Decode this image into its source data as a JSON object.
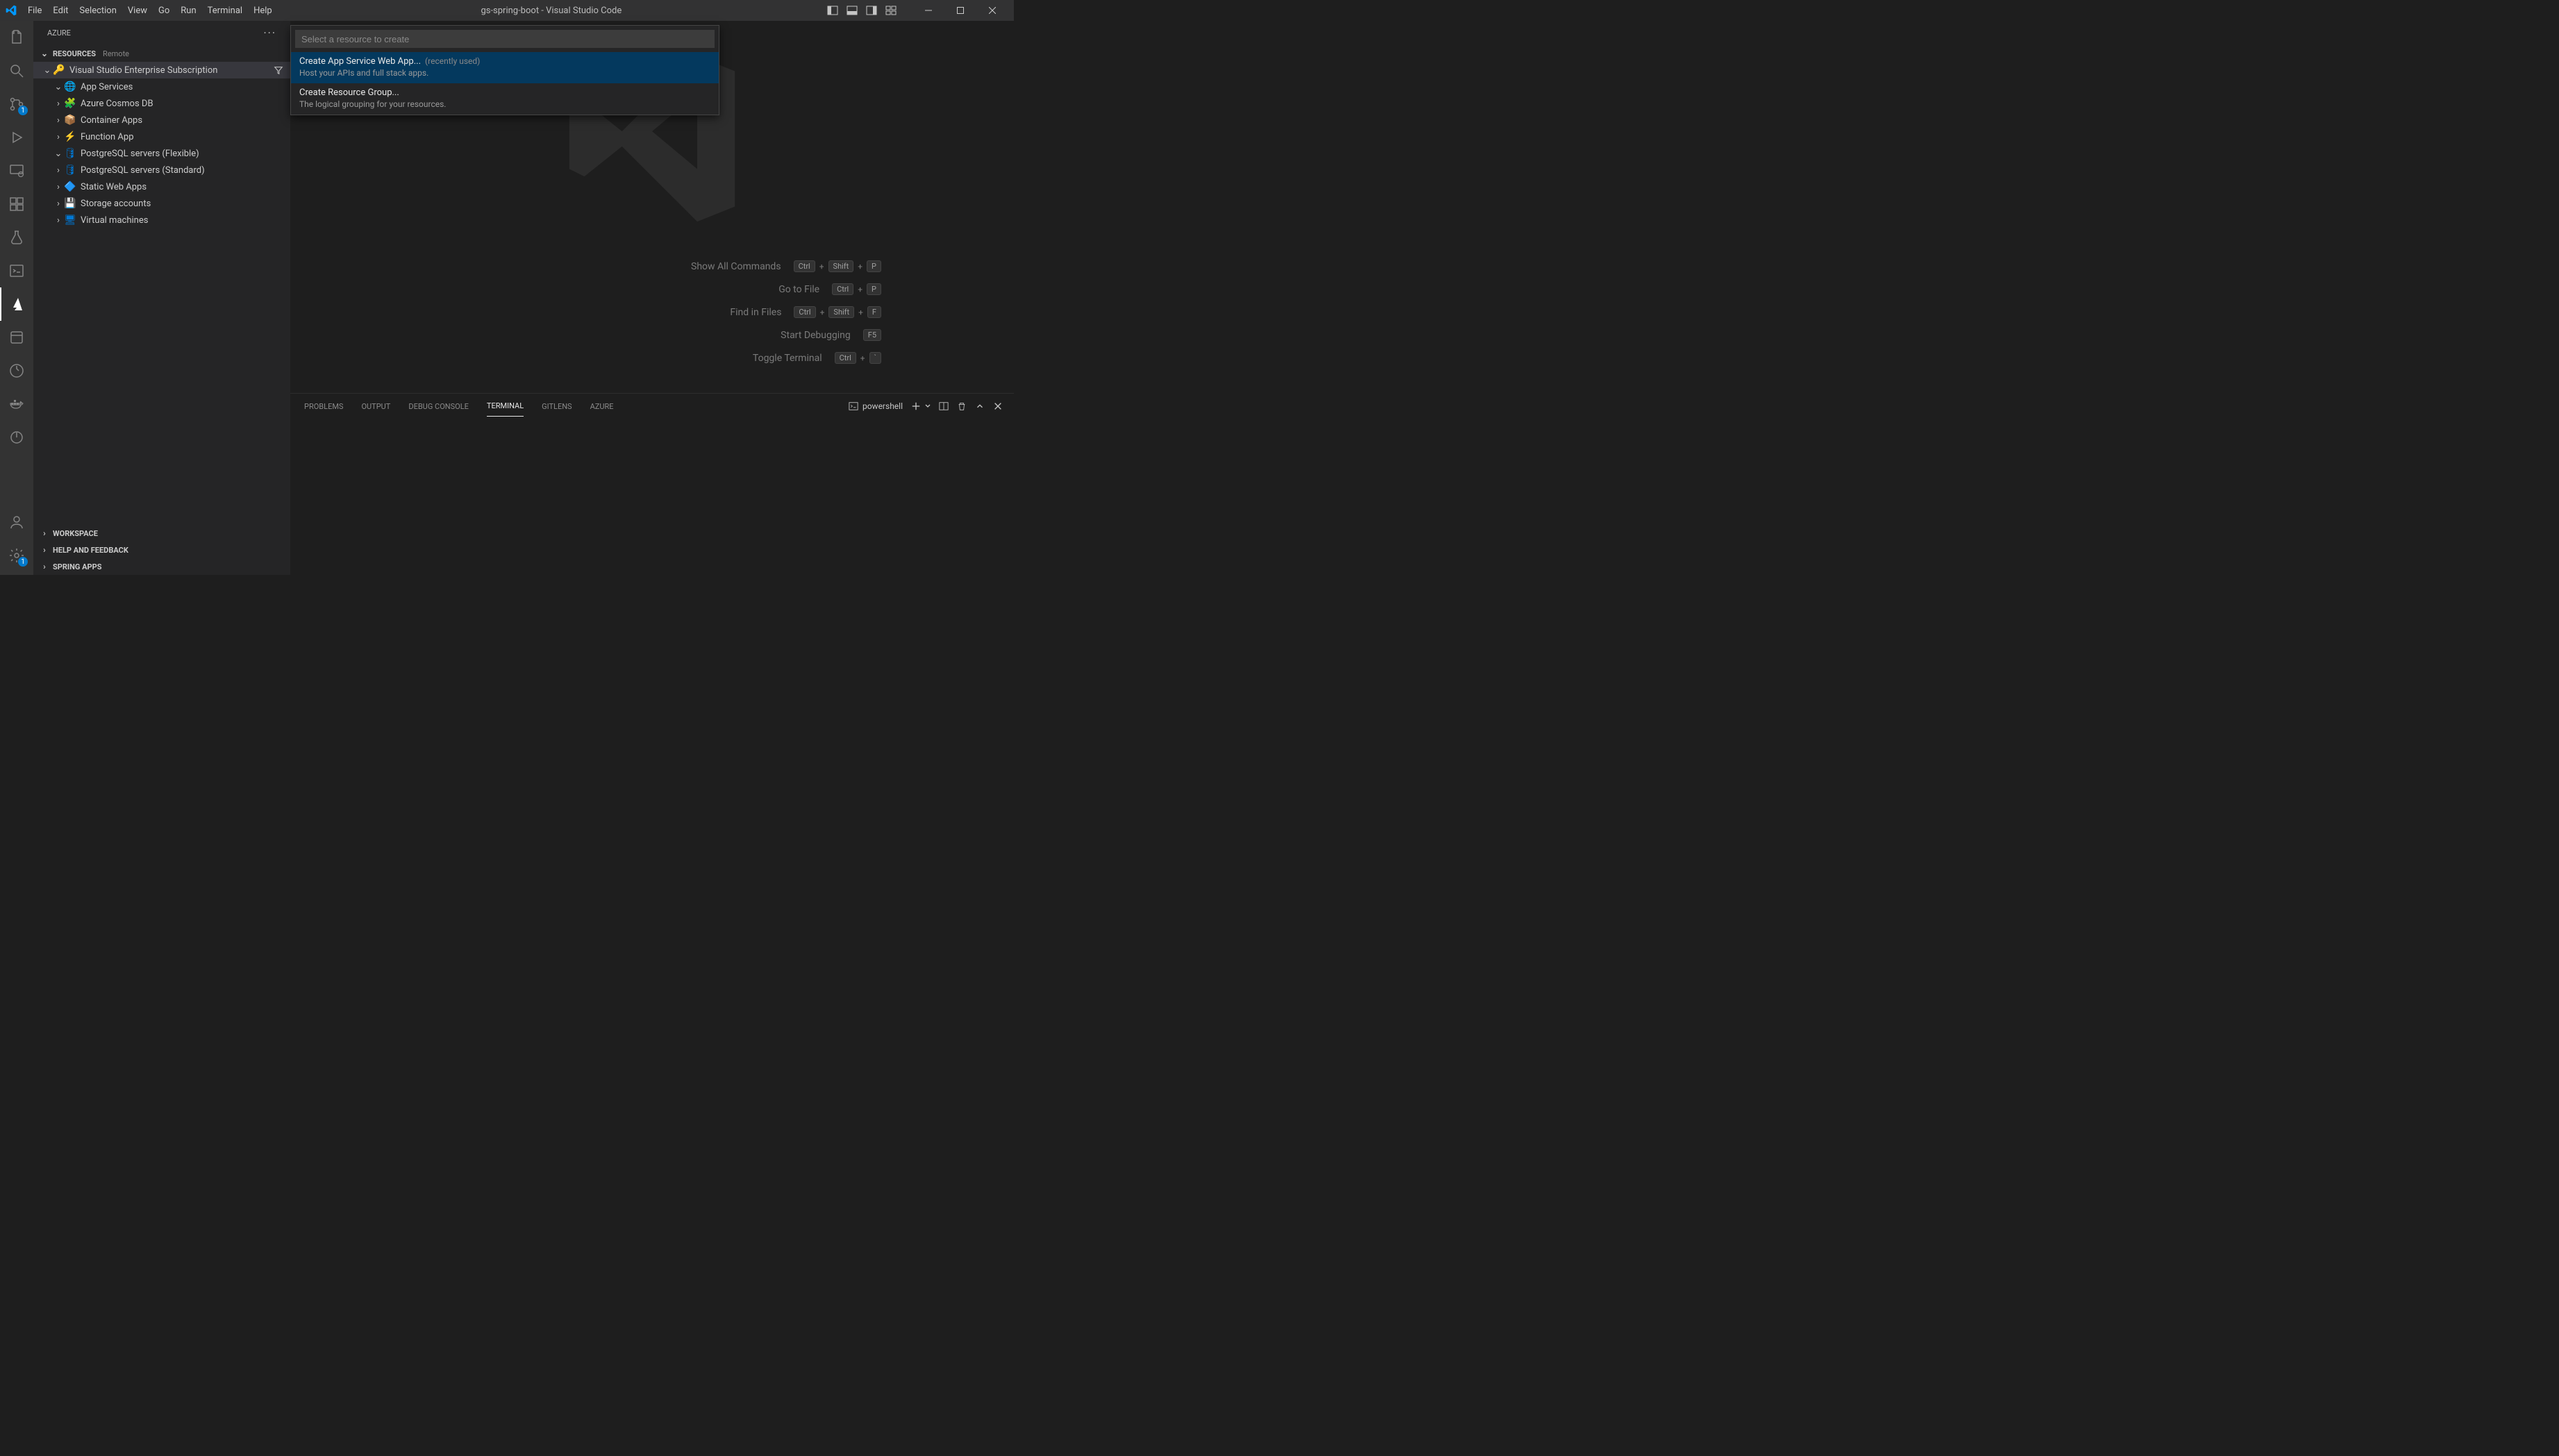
{
  "titleBar": {
    "menus": [
      "File",
      "Edit",
      "Selection",
      "View",
      "Go",
      "Run",
      "Terminal",
      "Help"
    ],
    "title": "gs-spring-boot - Visual Studio Code"
  },
  "activityBar": {
    "items": [
      {
        "name": "explorer-icon",
        "badge": ""
      },
      {
        "name": "search-icon",
        "badge": ""
      },
      {
        "name": "source-control-icon",
        "badge": "1"
      },
      {
        "name": "run-debug-icon",
        "badge": ""
      },
      {
        "name": "remote-explorer-icon",
        "badge": ""
      },
      {
        "name": "extensions-icon",
        "badge": ""
      },
      {
        "name": "testing-icon",
        "badge": ""
      },
      {
        "name": "terminal-pane-icon",
        "badge": ""
      },
      {
        "name": "azure-icon",
        "badge": "",
        "active": true
      },
      {
        "name": "projects-icon",
        "badge": ""
      },
      {
        "name": "git-graph-icon",
        "badge": ""
      },
      {
        "name": "docker-icon",
        "badge": ""
      },
      {
        "name": "power-icon",
        "badge": ""
      }
    ],
    "bottom": [
      {
        "name": "accounts-icon"
      },
      {
        "name": "settings-gear-icon",
        "badge": "1"
      }
    ]
  },
  "sidebar": {
    "title": "AZURE",
    "resourcesHeader": "RESOURCES",
    "resourcesMode": "Remote",
    "subscription": "Visual Studio Enterprise Subscription",
    "items": [
      {
        "label": "App Services",
        "expanded": true,
        "iconColor": "#0078d4",
        "glyph": "🌐"
      },
      {
        "label": "Azure Cosmos DB",
        "expanded": false,
        "iconColor": "#0078d4",
        "glyph": "🧩"
      },
      {
        "label": "Container Apps",
        "expanded": false,
        "iconColor": "#0078d4",
        "glyph": "📦"
      },
      {
        "label": "Function App",
        "expanded": false,
        "iconColor": "#ffb900",
        "glyph": "⚡"
      },
      {
        "label": "PostgreSQL servers (Flexible)",
        "expanded": true,
        "iconColor": "#0078d4",
        "glyph": "🛢"
      },
      {
        "label": "PostgreSQL servers (Standard)",
        "expanded": false,
        "iconColor": "#0078d4",
        "glyph": "🛢"
      },
      {
        "label": "Static Web Apps",
        "expanded": false,
        "iconColor": "#0078d4",
        "glyph": "🔷"
      },
      {
        "label": "Storage accounts",
        "expanded": false,
        "iconColor": "#2e7d32",
        "glyph": "💾"
      },
      {
        "label": "Virtual machines",
        "expanded": false,
        "iconColor": "#0078d4",
        "glyph": "🖥"
      }
    ],
    "collapsed": [
      "WORKSPACE",
      "HELP AND FEEDBACK",
      "SPRING APPS"
    ]
  },
  "quickPick": {
    "placeholder": "Select a resource to create",
    "items": [
      {
        "title": "Create App Service Web App...",
        "suffix": "(recently used)",
        "desc": "Host your APIs and full stack apps."
      },
      {
        "title": "Create Resource Group...",
        "suffix": "",
        "desc": "The logical grouping for your resources."
      }
    ]
  },
  "editor": {
    "shortcuts": [
      {
        "label": "Show All Commands",
        "keys": [
          "Ctrl",
          "Shift",
          "P"
        ]
      },
      {
        "label": "Go to File",
        "keys": [
          "Ctrl",
          "P"
        ]
      },
      {
        "label": "Find in Files",
        "keys": [
          "Ctrl",
          "Shift",
          "F"
        ]
      },
      {
        "label": "Start Debugging",
        "keys": [
          "F5"
        ]
      },
      {
        "label": "Toggle Terminal",
        "keys": [
          "Ctrl",
          "`"
        ]
      }
    ]
  },
  "panel": {
    "tabs": [
      "PROBLEMS",
      "OUTPUT",
      "DEBUG CONSOLE",
      "TERMINAL",
      "GITLENS",
      "AZURE"
    ],
    "activeTab": "TERMINAL",
    "terminalName": "powershell"
  }
}
